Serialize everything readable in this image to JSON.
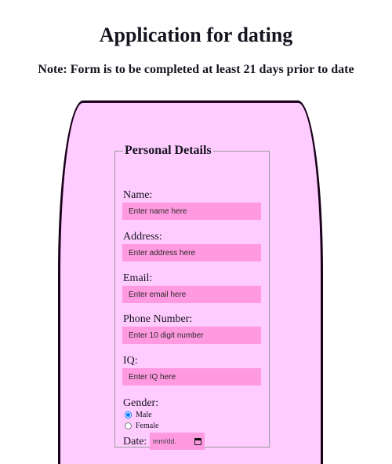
{
  "header": {
    "title": "Application for dating",
    "note": "Note: Form is to be completed at least 21 days prior to date"
  },
  "form": {
    "legend": "Personal Details",
    "fields": [
      {
        "label": "Name:",
        "placeholder": "Enter name here",
        "value": ""
      },
      {
        "label": "Address:",
        "placeholder": "Enter address here",
        "value": ""
      },
      {
        "label": "Email:",
        "placeholder": "Enter email here",
        "value": ""
      },
      {
        "label": "Phone Number:",
        "placeholder": "Enter 10 digit number",
        "value": ""
      },
      {
        "label": "IQ:",
        "placeholder": "Enter IQ here",
        "value": ""
      }
    ],
    "gender": {
      "label": "Gender:",
      "options": [
        {
          "label": "Male",
          "selected": true
        },
        {
          "label": "Female",
          "selected": false
        }
      ]
    },
    "date": {
      "label": "Date:",
      "placeholder": "mm/dd."
    }
  },
  "colors": {
    "card_background": "#ffccff",
    "input_background": "#ff99e0",
    "card_border": "#1a001a",
    "radio_accent": "#0075ff"
  }
}
